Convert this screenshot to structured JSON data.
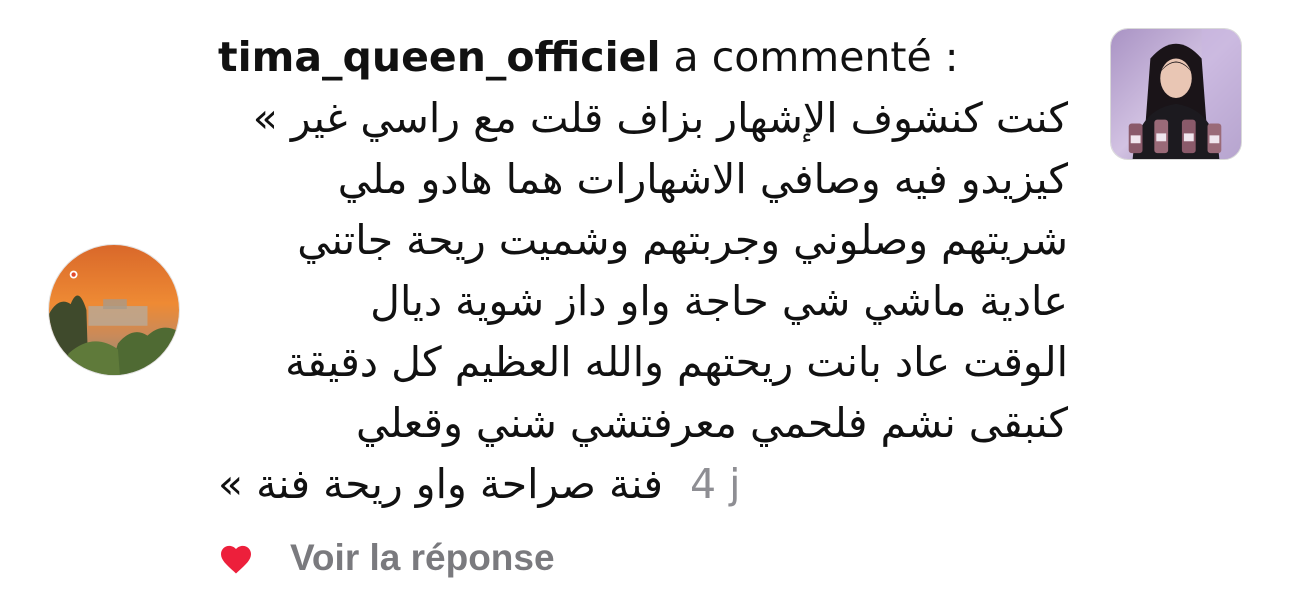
{
  "notification": {
    "username": "tima_queen_officiel",
    "action": "a commenté :",
    "comment_lines": [
      "كنت كنشوف الإشهار بزاف قلت مع راسي غير »",
      "كيزيدو فيه وصافي الاشهارات هما هادو ملي",
      "شريتهم وصلوني وجربتهم وشميت ريحة جاتني",
      "عادية ماشي شي حاجة واو داز شوية ديال",
      "الوقت عاد بانت ريحتهم والله العظيم كل دقيقة",
      "كنبقى نشم فلحمي معرفتشي شني وقعلي"
    ],
    "comment_last_line": "فنة  صراحة واو ريحة فنة »",
    "timestamp": "4 j",
    "reply_link": "Voir la réponse",
    "liked": true
  },
  "icons": {
    "avatar": "avatar-sunset-photo",
    "heart": "heart-icon",
    "thumbnail": "post-thumbnail-photo"
  },
  "colors": {
    "text": "#111111",
    "muted": "#8e8e93",
    "heart": "#ed1f3b",
    "reply_link": "#7a7a7e"
  }
}
